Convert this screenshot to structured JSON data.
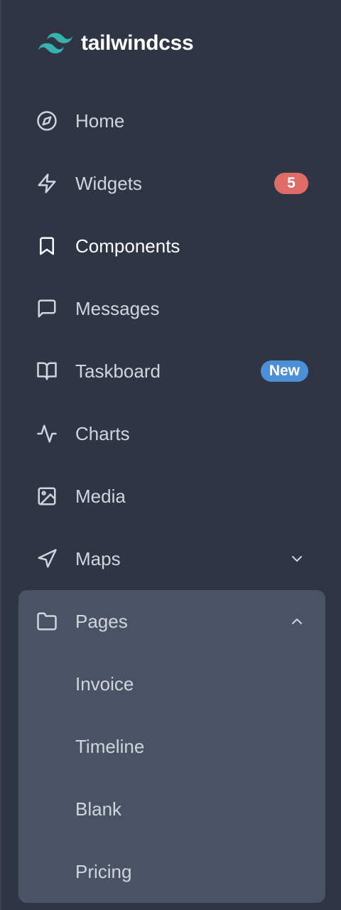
{
  "brand": {
    "name": "tailwindcss"
  },
  "colors": {
    "background": "#2f3545",
    "panel": "#4a5366",
    "badge_red": "#e06c67",
    "badge_blue": "#4b8fd6",
    "logo": "#38b2ac"
  },
  "nav": [
    {
      "label": "Home",
      "icon": "compass-icon"
    },
    {
      "label": "Widgets",
      "icon": "lightning-icon",
      "badge": "5"
    },
    {
      "label": "Components",
      "icon": "bookmark-icon",
      "active": true
    },
    {
      "label": "Messages",
      "icon": "message-square-icon"
    },
    {
      "label": "Taskboard",
      "icon": "book-open-icon",
      "badge": "New"
    },
    {
      "label": "Charts",
      "icon": "activity-icon"
    },
    {
      "label": "Media",
      "icon": "image-icon"
    },
    {
      "label": "Maps",
      "icon": "navigation-icon",
      "expanded": false
    },
    {
      "label": "Pages",
      "icon": "folder-icon",
      "expanded": true,
      "children": [
        {
          "label": "Invoice"
        },
        {
          "label": "Timeline"
        },
        {
          "label": "Blank"
        },
        {
          "label": "Pricing"
        }
      ]
    }
  ]
}
